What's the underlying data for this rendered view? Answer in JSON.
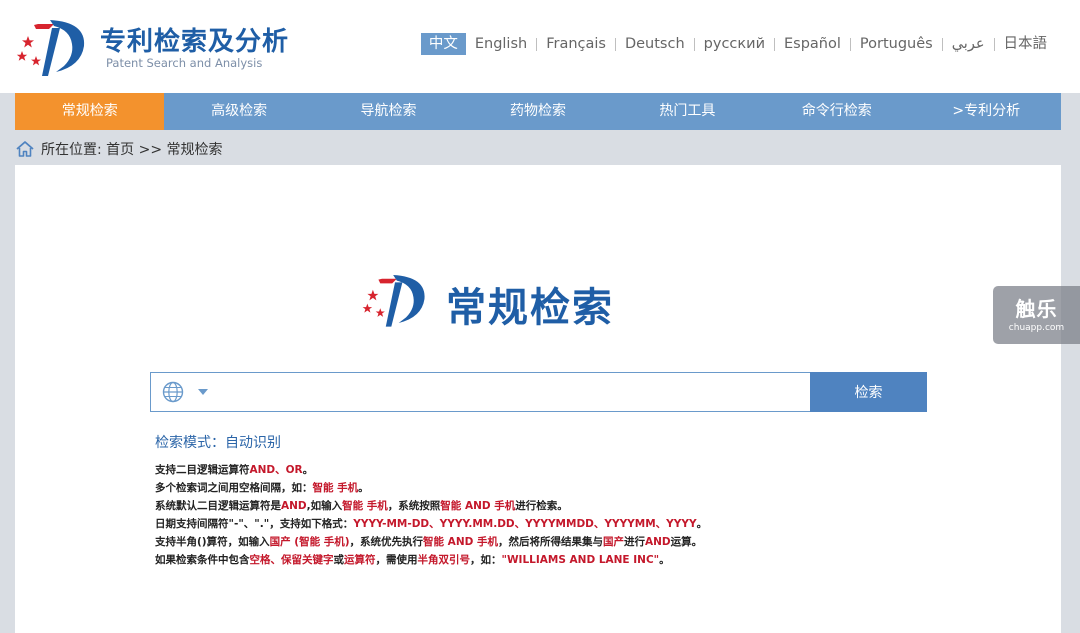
{
  "header": {
    "logo_cn": "专利检索及分析",
    "logo_en": "Patent Search and Analysis",
    "languages": [
      "中文",
      "English",
      "Français",
      "Deutsch",
      "русский",
      "Español",
      "Português",
      "عربي",
      "日本語"
    ]
  },
  "nav": {
    "items": [
      "常规检索",
      "高级检索",
      "导航检索",
      "药物检索",
      "热门工具",
      "命令行检索",
      ">专利分析"
    ],
    "active_index": 0
  },
  "breadcrumb": {
    "label": "所在位置: 首页 >> 常规检索"
  },
  "main": {
    "title": "常规检索",
    "search": {
      "value": "",
      "button_label": "检索"
    },
    "mode_label": "检索模式：自动识别",
    "tips": [
      [
        {
          "t": "支持二目逻辑运算符",
          "r": false
        },
        {
          "t": "AND、OR",
          "r": true
        },
        {
          "t": "。",
          "r": false
        }
      ],
      [
        {
          "t": "多个检索词之间用空格间隔，如：",
          "r": false
        },
        {
          "t": "智能 手机",
          "r": true
        },
        {
          "t": "。",
          "r": false
        }
      ],
      [
        {
          "t": "系统默认二目逻辑运算符是",
          "r": false
        },
        {
          "t": "AND",
          "r": true
        },
        {
          "t": ",如输入",
          "r": false
        },
        {
          "t": "智能 手机",
          "r": true
        },
        {
          "t": "，系统按照",
          "r": false
        },
        {
          "t": "智能 AND 手机",
          "r": true
        },
        {
          "t": "进行检索。",
          "r": false
        }
      ],
      [
        {
          "t": "日期支持间隔符\"-\"、\".\"，支持如下格式：",
          "r": false
        },
        {
          "t": "YYYY-MM-DD、YYYY.MM.DD、YYYYMMDD、YYYYMM、YYYY",
          "r": true
        },
        {
          "t": "。",
          "r": false
        }
      ],
      [
        {
          "t": "支持半角()算符，如输入",
          "r": false
        },
        {
          "t": "国产 (智能 手机)",
          "r": true
        },
        {
          "t": "，系统优先执行",
          "r": false
        },
        {
          "t": "智能 AND 手机",
          "r": true
        },
        {
          "t": "，然后将所得结果集与",
          "r": false
        },
        {
          "t": "国产",
          "r": true
        },
        {
          "t": "进行",
          "r": false
        },
        {
          "t": "AND",
          "r": true
        },
        {
          "t": "运算。",
          "r": false
        }
      ],
      [
        {
          "t": "如果检索条件中包含",
          "r": false
        },
        {
          "t": "空格、保留关键字",
          "r": true
        },
        {
          "t": "或",
          "r": false
        },
        {
          "t": "运算符",
          "r": true
        },
        {
          "t": "，需使用",
          "r": false
        },
        {
          "t": "半角双引号",
          "r": true
        },
        {
          "t": "，如：",
          "r": false
        },
        {
          "t": "\"WILLIAMS AND LANE INC\"",
          "r": true
        },
        {
          "t": "。",
          "r": false
        }
      ]
    ]
  },
  "watermark": {
    "main": "触乐",
    "sub": "chuapp.com"
  },
  "colors": {
    "brand_blue": "#1f5ea6",
    "nav_blue": "#6a9acb",
    "nav_active_orange": "#f3922d",
    "button_blue": "#4f83c0",
    "highlight_red": "#c4182b",
    "logo_star_red": "#d7242e"
  },
  "icons": [
    "logo-emblem-icon",
    "home-icon",
    "globe-icon",
    "chevron-down-icon"
  ]
}
